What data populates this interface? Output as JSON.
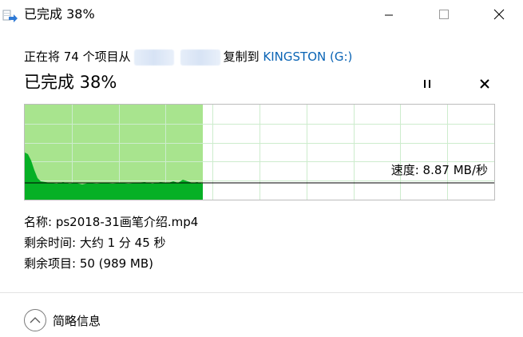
{
  "window": {
    "title": "已完成 38%",
    "controls": {
      "minimize": "minimize-icon",
      "maximize": "maximize-icon",
      "close": "close-icon"
    }
  },
  "copy": {
    "prefix": "正在将 74 个项目从",
    "middle": "复制到",
    "destination": "KINGSTON (G:)",
    "source_obscured": true
  },
  "progress": {
    "label": "已完成 38%",
    "percent": 38,
    "pause_icon": "pause-icon",
    "stop_icon": "close-icon"
  },
  "speed": {
    "label": "速度: 8.87 MB/秒",
    "colors": {
      "completed_fill": "#a8e48e",
      "speed_area": "#06b025",
      "grid": "#cdeccd",
      "border": "#bcbcbc"
    }
  },
  "details": {
    "name": "名称: ps2018-31画笔介绍.mp4",
    "time_remaining": "剩余时间: 大约 1 分 45 秒",
    "items_remaining": "剩余项目: 50 (989 MB)"
  },
  "footer": {
    "toggle_label": "简略信息",
    "toggle_icon": "chevron-up-icon"
  }
}
